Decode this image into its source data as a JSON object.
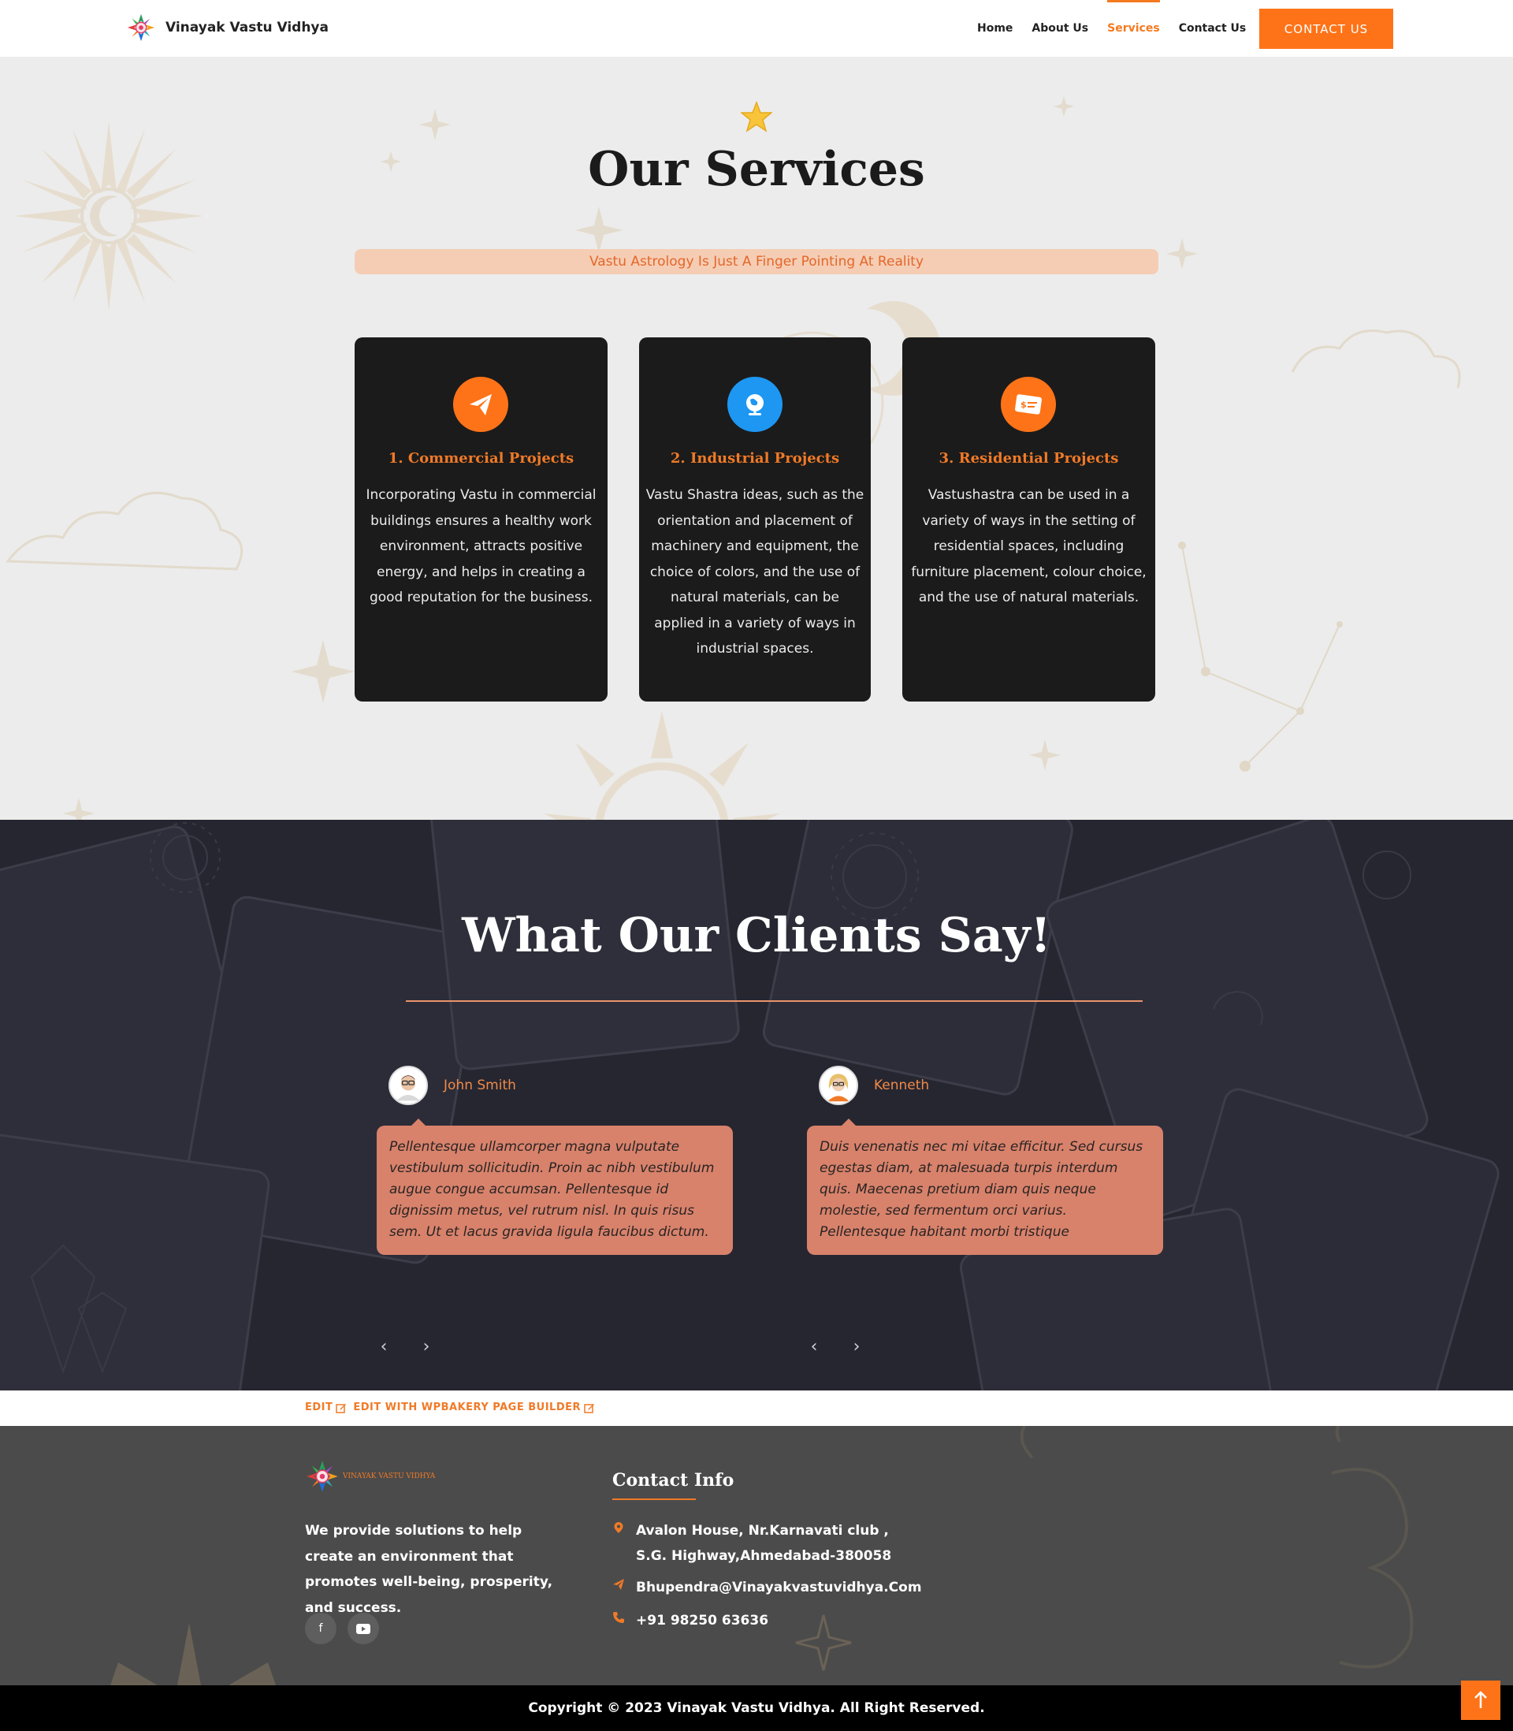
{
  "header": {
    "brand": "Vinayak Vastu Vidhya",
    "nav": [
      "Home",
      "About Us",
      "Services",
      "Contact Us"
    ],
    "active_nav": "Services",
    "cta": "CONTACT US"
  },
  "services": {
    "title": "Our Services",
    "tagline": "Vastu Astrology Is Just A Finger Pointing At Reality",
    "cards": [
      {
        "title": "1. Commercial Projects",
        "text": "Incorporating Vastu in commercial buildings ensures a healthy work environment, attracts positive energy, and helps in creating a good reputation for the business.",
        "icon": "paper-plane-icon",
        "color": "#fe7318"
      },
      {
        "title": "2. Industrial Projects",
        "text": "Vastu Shastra ideas, such as the orientation and placement of machinery and equipment, the choice of colors, and the use of natural materials, can be applied in a variety of ways in industrial spaces.",
        "icon": "globe-icon",
        "color": "#1d97f2"
      },
      {
        "title": "3. Residential Projects",
        "text": "Vastushastra can be used in a variety of ways in the setting of residential spaces, including furniture placement, colour choice, and the use of natural materials.",
        "icon": "money-card-icon",
        "color": "#fe7318"
      }
    ]
  },
  "testimonials": {
    "title": "What Our Clients Say!",
    "clients": [
      {
        "name": "John Smith",
        "text": "Pellentesque ullamcorper magna vulputate vestibulum sollicitudin. Proin ac nibh vestibulum augue congue accumsan. Pellentesque id dignissim metus, vel rutrum nisl. In quis risus sem. Ut et lacus gravida ligula faucibus dictum."
      },
      {
        "name": "Kenneth",
        "text": "Duis venenatis nec mi vitae efficitur. Sed cursus egestas diam, at malesuada turpis interdum quis. Maecenas pretium diam quis neque molestie, sed fermentum orci varius. Pellentesque habitant morbi tristique"
      }
    ],
    "prev": "‹",
    "next": "›"
  },
  "editbar": {
    "edit": "EDIT",
    "edit_builder": "EDIT WITH WPBAKERY PAGE BUILDER"
  },
  "footer": {
    "logo_text": "VINAYAK VASTU VIDHYA",
    "about": "We provide solutions to help create an environment that promotes well-being, prosperity, and success.",
    "social": [
      {
        "icon": "facebook-icon",
        "glyph": "f"
      },
      {
        "icon": "youtube-icon",
        "glyph": "▶"
      }
    ],
    "contact_title": "Contact Info",
    "address": "Avalon House, Nr.Karnavati club , S.G. Highway,Ahmedabad-380058",
    "email": "Bhupendra@Vinayakvastuvidhya.Com",
    "phone": "+91 98250 63636",
    "copyright": "Copyright © 2023 Vinayak Vastu Vidhya. All Right Reserved."
  },
  "colors": {
    "accent": "#fe7318",
    "dark_card": "#1b1b1b",
    "testimonial_bg": "#262631",
    "bubble": "#d8826b",
    "footer_bg": "#4b4b4b"
  }
}
